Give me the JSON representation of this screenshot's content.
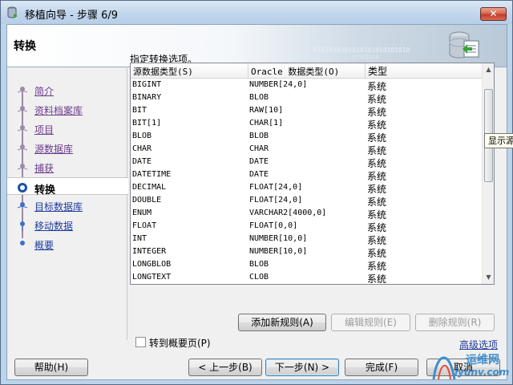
{
  "window": {
    "title": "移植向导 - 步骤 6/9",
    "close_label": "✕"
  },
  "header": {
    "title": "转换",
    "art_text": "0101010101010101010101010"
  },
  "nav": {
    "items": [
      {
        "label": "简介",
        "state": "done"
      },
      {
        "label": "资料档案库",
        "state": "done"
      },
      {
        "label": "项目",
        "state": "done"
      },
      {
        "label": "源数据库",
        "state": "done"
      },
      {
        "label": "捕获",
        "state": "done"
      },
      {
        "label": "转换",
        "state": "current"
      },
      {
        "label": "目标数据库",
        "state": "future"
      },
      {
        "label": "移动数据",
        "state": "future"
      },
      {
        "label": "概要",
        "state": "future"
      }
    ]
  },
  "main": {
    "instruction": "指定转换选项。",
    "columns": [
      "源数据类型(S)",
      "Oracle 数据类型(O)",
      "类型"
    ],
    "rows": [
      [
        "BIGINT",
        "NUMBER[24,0]",
        "系统"
      ],
      [
        "BINARY",
        "BLOB",
        "系统"
      ],
      [
        "BIT",
        "RAW[10]",
        "系统"
      ],
      [
        "BIT[1]",
        "CHAR[1]",
        "系统"
      ],
      [
        "BLOB",
        "BLOB",
        "系统"
      ],
      [
        "CHAR",
        "CHAR",
        "系统"
      ],
      [
        "DATE",
        "DATE",
        "系统"
      ],
      [
        "DATETIME",
        "DATE",
        "系统"
      ],
      [
        "DECIMAL",
        "FLOAT[24,0]",
        "系统"
      ],
      [
        "DOUBLE",
        "FLOAT[24,0]",
        "系统"
      ],
      [
        "ENUM",
        "VARCHAR2[4000,0]",
        "系统"
      ],
      [
        "FLOAT",
        "FLOAT[0,0]",
        "系统"
      ],
      [
        "INT",
        "NUMBER[10,0]",
        "系统"
      ],
      [
        "INTEGER",
        "NUMBER[10,0]",
        "系统"
      ],
      [
        "LONGBLOB",
        "BLOB",
        "系统"
      ],
      [
        "LONGTEXT",
        "CLOB",
        "系统"
      ]
    ],
    "tooltip": "显示源",
    "add_rule": "添加新规则(A)",
    "edit_rule": "编辑规则(E)",
    "delete_rule": "删除规则(R)",
    "goto_summary": "转到概要页(P)",
    "advanced_options": "高级选项"
  },
  "footer": {
    "help": "帮助(H)",
    "back": "< 上一步(B)",
    "next": "下一步(N) >",
    "finish": "完成(F)",
    "cancel": "取消"
  },
  "watermark": {
    "line1": "运维网",
    "line2": "iyunv.com"
  },
  "colors": {
    "titlebar": "#c2d6ec",
    "nav_link_visited": "#6b3b8c",
    "nav_link_future": "#1f3b9c",
    "close_button": "#c0392b"
  }
}
